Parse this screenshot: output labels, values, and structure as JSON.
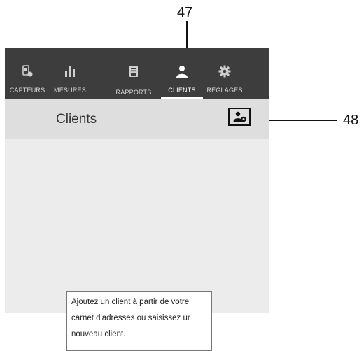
{
  "annotations": {
    "tab_ref": "47",
    "button_ref": "48"
  },
  "tabs": [
    {
      "label": "CAPTEURS",
      "icon": "sensor-icon",
      "active": false
    },
    {
      "label": "MESURES",
      "icon": "bar-chart-icon",
      "active": false
    },
    {
      "label": "RAPPORTS",
      "icon": "report-icon",
      "active": false
    },
    {
      "label": "CLIENTS",
      "icon": "person-icon",
      "active": true
    },
    {
      "label": "REGLAGES",
      "icon": "gear-icon",
      "active": false
    }
  ],
  "header": {
    "title": "Clients",
    "add_button_icon": "add-client-icon"
  },
  "content": {
    "hint_text": "Ajoutez un client à partir de votre carnet d'adresses ou saisissez ur nouveau client."
  },
  "colors": {
    "tabbar": "#3d3d3d",
    "header": "#dedede",
    "content": "#ececec"
  }
}
